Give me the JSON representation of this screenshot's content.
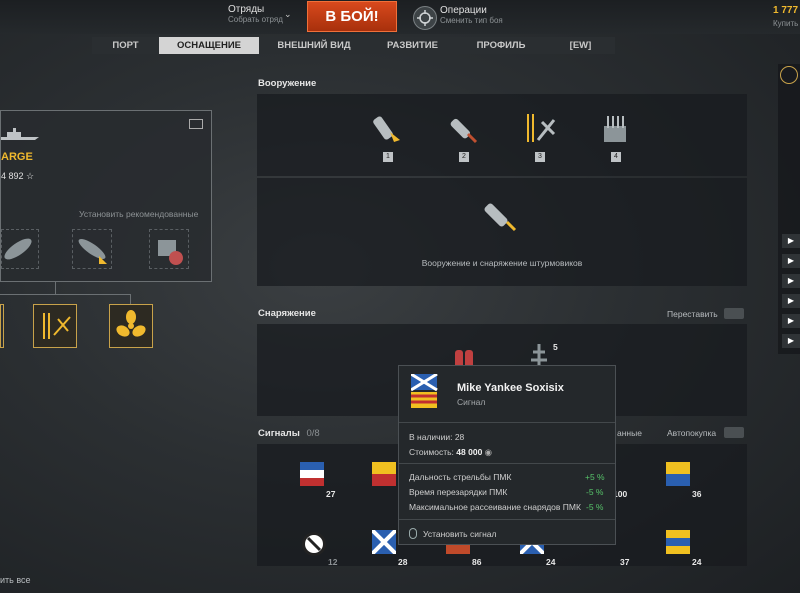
{
  "topbar": {
    "squads_label": "Отряды",
    "squads_sub": "Собрать отряд",
    "battle_label": "В БОЙ!",
    "ops_label": "Операции",
    "ops_sub": "Сменить тип боя",
    "credits": "1 777",
    "buy_label": "Купить"
  },
  "tabs": [
    {
      "label": "ПОРТ",
      "active": false
    },
    {
      "label": "ОСНАЩЕНИЕ",
      "active": true
    },
    {
      "label": "ВНЕШНИЙ ВИД",
      "active": false
    },
    {
      "label": "РАЗВИТИЕ",
      "active": false
    },
    {
      "label": "ПРОФИЛЬ",
      "active": false
    },
    {
      "label": "[EW]",
      "active": false
    }
  ],
  "ship": {
    "name_fragment": "ARGE",
    "xp": "4 892 ☆",
    "recommended_label": "Установить рекомендованные"
  },
  "armament": {
    "title": "Вооружение",
    "slots": [
      "1",
      "2",
      "3",
      "4"
    ],
    "caption": "Вооружение и снаряжение штурмовиков"
  },
  "equipment": {
    "title": "Снаряжение",
    "rearrange_label": "Переставить",
    "count": "5"
  },
  "signals": {
    "title": "Сигналы",
    "count": "0/8",
    "recommended_fragment": "анные",
    "autobuy_label": "Автопокупка",
    "row1": [
      "27",
      "",
      "",
      "",
      "100",
      "36"
    ],
    "row2": [
      "12",
      "28",
      "86",
      "24",
      "37",
      "24"
    ]
  },
  "tooltip": {
    "title": "Mike Yankee Soxisix",
    "subtitle": "Сигнал",
    "stock_label": "В наличии:",
    "stock_value": "28",
    "cost_label": "Стоимость:",
    "cost_value": "48 000",
    "effects": [
      {
        "label": "Дальность стрельбы ПМК",
        "value": "+5 %"
      },
      {
        "label": "Время перезарядки ПМК",
        "value": "-5 %"
      },
      {
        "label": "Максимальное рассеивание снарядов ПМК",
        "value": "-5 %"
      }
    ],
    "action": "Установить сигнал"
  },
  "bottom": {
    "remove_all_fragment": "ить все"
  },
  "colors": {
    "battle_button": "#c43a12",
    "accent_gold": "#f0b92e",
    "positive": "#57c46a"
  }
}
